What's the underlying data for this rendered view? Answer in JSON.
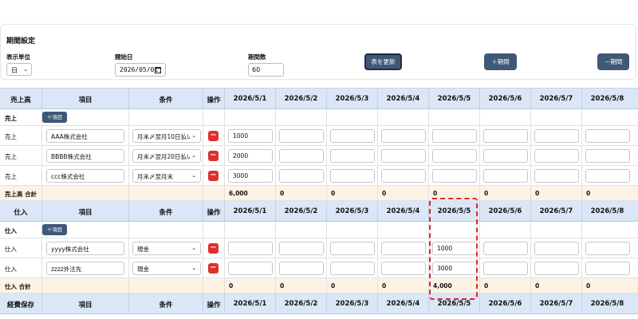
{
  "settings": {
    "title": "期間設定",
    "unit_label": "表示単位",
    "unit_value": "日",
    "start_label": "開始日",
    "start_value": "2026/05/01",
    "period_label": "期間数",
    "period_value": "60",
    "update_button": "表を更新",
    "add_button": "＋期間",
    "remove_button": "－期間"
  },
  "dates": [
    "2026/5/1",
    "2026/5/2",
    "2026/5/3",
    "2026/5/4",
    "2026/5/5",
    "2026/5/6",
    "2026/5/7",
    "2026/5/8"
  ],
  "sales": {
    "header": {
      "kind": "売上高",
      "item": "項目",
      "condition": "条件",
      "action": "操作"
    },
    "group_label": "売上",
    "add_item": "＋項目",
    "rows": [
      {
        "kind": "売上",
        "name": "AAA株式会社",
        "condition": "月末〆翌月10日払い",
        "values": [
          "1000",
          "",
          "",
          "",
          "",
          "",
          "",
          ""
        ]
      },
      {
        "kind": "売上",
        "name": "BBBB株式会社",
        "condition": "月末〆翌月20日払い",
        "values": [
          "2000",
          "",
          "",
          "",
          "",
          "",
          "",
          ""
        ]
      },
      {
        "kind": "売上",
        "name": "ccc株式会社",
        "condition": "月末〆翌月末",
        "values": [
          "3000",
          "",
          "",
          "",
          "",
          "",
          "",
          ""
        ]
      }
    ],
    "total_label": "売上高 合計",
    "totals": [
      "6,000",
      "0",
      "0",
      "0",
      "0",
      "0",
      "0",
      "0"
    ]
  },
  "purchase": {
    "header": {
      "kind": "仕入",
      "item": "項目",
      "condition": "条件",
      "action": "操作"
    },
    "group_label": "仕入",
    "add_item": "＋項目",
    "rows": [
      {
        "kind": "仕入",
        "name": "yyyy株式会社",
        "condition": "現金",
        "values": [
          "",
          "",
          "",
          "",
          "1000",
          "",
          "",
          ""
        ]
      },
      {
        "kind": "仕入",
        "name": "zzzz外注先",
        "condition": "現金",
        "values": [
          "",
          "",
          "",
          "",
          "3000",
          "",
          "",
          ""
        ]
      }
    ],
    "total_label": "仕入 合計",
    "totals": [
      "0",
      "0",
      "0",
      "0",
      "4,000",
      "0",
      "0",
      "0"
    ]
  },
  "next_section": {
    "header": {
      "kind": "経費保存",
      "item": "項目",
      "condition": "条件",
      "action": "操作"
    },
    "dates_partial": [
      "2026/5/1",
      "2026/5/2",
      "2026/5/3",
      "2026/5/4",
      "2026/5/5",
      "2026/5/6",
      "2026/5/7",
      "2026/5/8"
    ]
  },
  "icons": {
    "chevron": "chevron-down-icon",
    "calendar": "calendar-icon",
    "delete": "minus-icon"
  },
  "colors": {
    "header_bg": "#dbe7f7",
    "total_bg": "#fdf3e4",
    "button": "#3f5878",
    "delete": "#e0302c",
    "highlight": "#e0252a"
  }
}
